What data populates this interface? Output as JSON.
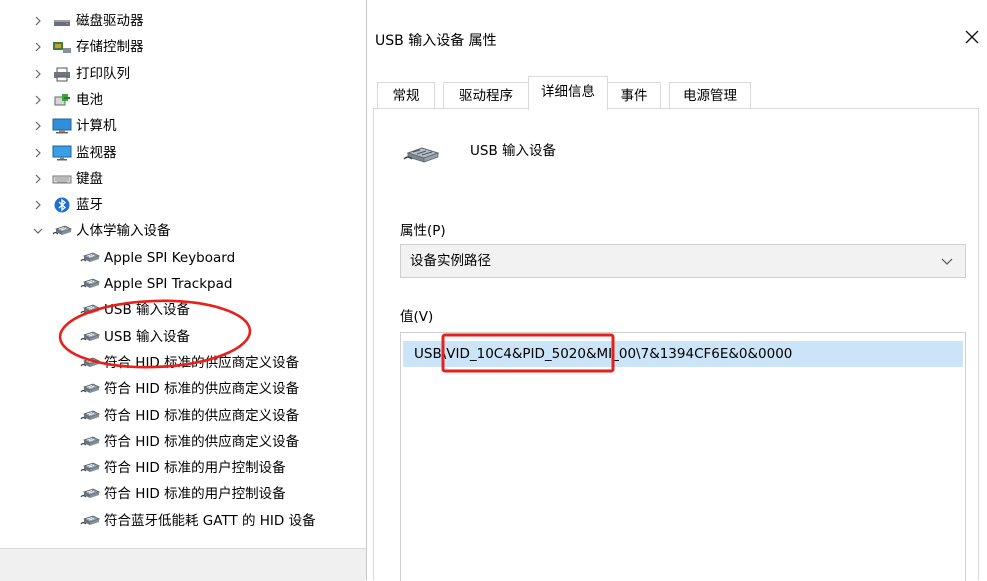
{
  "tree": {
    "items": [
      {
        "expander": "collapsed",
        "icon": "disk-drive-icon",
        "label": "磁盘驱动器"
      },
      {
        "expander": "collapsed",
        "icon": "storage-controller-icon",
        "label": "存储控制器"
      },
      {
        "expander": "collapsed",
        "icon": "print-queue-icon",
        "label": "打印队列"
      },
      {
        "expander": "collapsed",
        "icon": "battery-icon",
        "label": "电池"
      },
      {
        "expander": "collapsed",
        "icon": "computer-icon",
        "label": "计算机"
      },
      {
        "expander": "collapsed",
        "icon": "monitor-icon",
        "label": "监视器"
      },
      {
        "expander": "collapsed",
        "icon": "keyboard-icon",
        "label": "键盘"
      },
      {
        "expander": "collapsed",
        "icon": "bluetooth-icon",
        "label": "蓝牙"
      },
      {
        "expander": "expanded",
        "icon": "hid-icon",
        "label": "人体学输入设备"
      },
      {
        "expander": "none",
        "icon": "hid-icon",
        "label": "Apple SPI Keyboard"
      },
      {
        "expander": "none",
        "icon": "hid-icon",
        "label": "Apple SPI Trackpad"
      },
      {
        "expander": "none",
        "icon": "hid-icon",
        "label": "USB 输入设备"
      },
      {
        "expander": "none",
        "icon": "hid-icon",
        "label": "USB 输入设备"
      },
      {
        "expander": "none",
        "icon": "hid-icon",
        "label": "符合 HID 标准的供应商定义设备"
      },
      {
        "expander": "none",
        "icon": "hid-icon",
        "label": "符合 HID 标准的供应商定义设备"
      },
      {
        "expander": "none",
        "icon": "hid-icon",
        "label": "符合 HID 标准的供应商定义设备"
      },
      {
        "expander": "none",
        "icon": "hid-icon",
        "label": "符合 HID 标准的供应商定义设备"
      },
      {
        "expander": "none",
        "icon": "hid-icon",
        "label": "符合 HID 标准的用户控制设备"
      },
      {
        "expander": "none",
        "icon": "hid-icon",
        "label": "符合 HID 标准的用户控制设备"
      },
      {
        "expander": "none",
        "icon": "hid-icon",
        "label": "符合蓝牙低能耗 GATT 的 HID 设备"
      }
    ]
  },
  "dialog": {
    "title": "USB 输入设备 属性",
    "tabs": [
      {
        "label": "常规"
      },
      {
        "label": "驱动程序"
      },
      {
        "label": "详细信息",
        "active": true
      },
      {
        "label": "事件"
      },
      {
        "label": "电源管理"
      }
    ],
    "device_name": "USB 输入设备",
    "property_label": "属性(P)",
    "property_value": "设备实例路径",
    "value_label": "值(V)",
    "value_text": "USB\\VID_10C4&PID_5020&MI_00\\7&1394CF6E&0&0000"
  },
  "colors": {
    "annotation_red": "#e8201a",
    "selection_bg": "#cce4f7",
    "chrome_bg": "#f0f0f0"
  }
}
